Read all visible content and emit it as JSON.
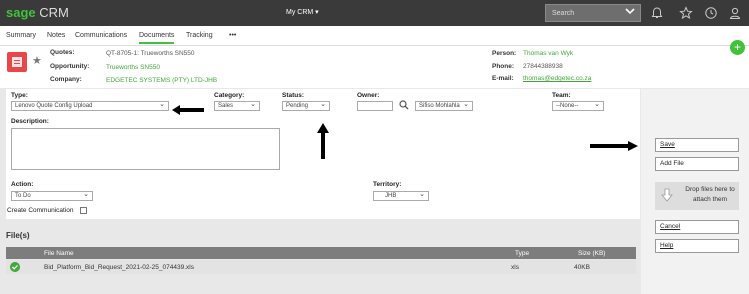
{
  "topbar": {
    "logo_brand": "sage",
    "logo_product": "CRM",
    "context_menu": "My CRM ▾",
    "search_placeholder": "Search"
  },
  "tabs": [
    {
      "label": "Summary"
    },
    {
      "label": "Notes"
    },
    {
      "label": "Communications"
    },
    {
      "label": "Documents",
      "active": true
    },
    {
      "label": "Tracking"
    },
    {
      "label": "•••"
    }
  ],
  "header": {
    "quotes_label": "Quotes:",
    "quotes_value": "QT-8705-1: Trueworths SN550",
    "opportunity_label": "Opportunity:",
    "opportunity_value": "Trueworths SN550",
    "company_label": "Company:",
    "company_value": "EDGETEC SYSTEMS (PTY) LTD-JHB",
    "person_label": "Person:",
    "person_value": "Thomas van Wyk",
    "phone_label": "Phone:",
    "phone_value": "27844388938",
    "email_label": "E-mail:",
    "email_value": "thomas@edgetec.co.za"
  },
  "form": {
    "type_label": "Type:",
    "type_value": "Lenovo Quote Config Upload",
    "category_label": "Category:",
    "category_value": "Sales",
    "status_label": "Status:",
    "status_value": "Pending",
    "owner_label": "Owner:",
    "owner_value": "Sifiso Mohlahla",
    "team_label": "Team:",
    "team_value": "--None--",
    "description_label": "Description:",
    "action_label": "Action:",
    "action_value": "To Do",
    "territory_label": "Territory:",
    "territory_value": "JHB",
    "create_comm_label": "Create Communication"
  },
  "actions": {
    "save": "Save",
    "add_file": "Add File",
    "drop_text": "Drop files here to attach them",
    "cancel": "Cancel",
    "help": "Help"
  },
  "files": {
    "title": "File(s)",
    "columns": [
      "File Name",
      "Type",
      "Size (KB)"
    ],
    "rows": [
      {
        "name": "Bid_Platform_Bid_Request_2021-02-25_074439.xls",
        "type": "xls",
        "size": "40KB"
      }
    ]
  },
  "colors": {
    "brand_green": "#41c23a",
    "topbar": "#3a3a3a",
    "quote_icon": "#e8474a"
  }
}
